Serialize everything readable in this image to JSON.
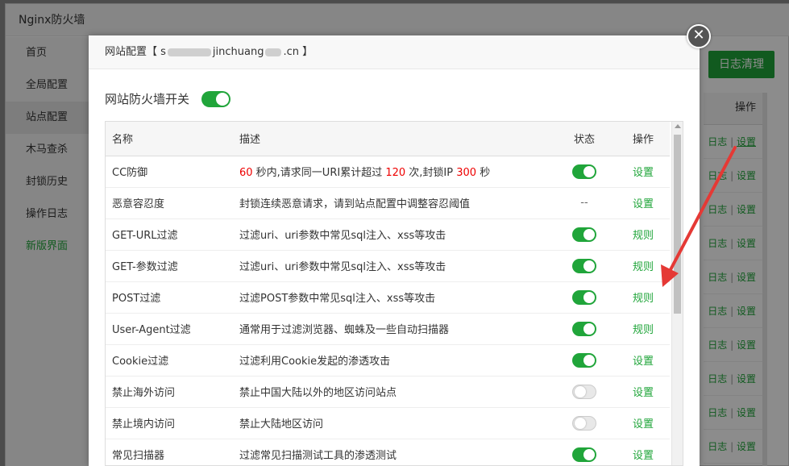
{
  "app": {
    "title": "Nginx防火墙",
    "sidebar": [
      "首页",
      "全局配置",
      "站点配置",
      "木马查杀",
      "封锁历史",
      "操作日志",
      "新版界面"
    ],
    "log_clear_button": "日志清理",
    "op_header": "操作",
    "row_links": {
      "log": "日志",
      "sep": "|",
      "set": "设置"
    }
  },
  "modal": {
    "title_prefix": "网站配置【 s",
    "title_suffix": "jinchuang",
    "title_end": ".cn 】",
    "firewall_switch_label": "网站防火墙开关",
    "columns": {
      "name": "名称",
      "desc": "描述",
      "state": "状态",
      "op": "操作"
    },
    "rows": [
      {
        "name": "CC防御",
        "desc_parts": [
          "60",
          " 秒内,请求同一URI累计超过 ",
          "120",
          " 次,封锁IP ",
          "300",
          " 秒"
        ],
        "state": "on",
        "op": "设置"
      },
      {
        "name": "恶意容忍度",
        "desc": "封锁连续恶意请求，请到站点配置中调整容忍阈值",
        "state": "--",
        "op": "设置"
      },
      {
        "name": "GET-URL过滤",
        "desc": "过滤uri、uri参数中常见sql注入、xss等攻击",
        "state": "on",
        "op": "规则"
      },
      {
        "name": "GET-参数过滤",
        "desc": "过滤uri、uri参数中常见sql注入、xss等攻击",
        "state": "on",
        "op": "规则"
      },
      {
        "name": "POST过滤",
        "desc": "过滤POST参数中常见sql注入、xss等攻击",
        "state": "on",
        "op": "规则"
      },
      {
        "name": "User-Agent过滤",
        "desc": "通常用于过滤浏览器、蜘蛛及一些自动扫描器",
        "state": "on",
        "op": "规则"
      },
      {
        "name": "Cookie过滤",
        "desc": "过滤利用Cookie发起的渗透攻击",
        "state": "on",
        "op": "设置"
      },
      {
        "name": "禁止海外访问",
        "desc": "禁止中国大陆以外的地区访问站点",
        "state": "off",
        "op": "设置"
      },
      {
        "name": "禁止境内访问",
        "desc": "禁止大陆地区访问",
        "state": "off",
        "op": "设置"
      },
      {
        "name": "常见扫描器",
        "desc": "过滤常见扫描测试工具的渗透测试",
        "state": "on",
        "op": "设置"
      }
    ]
  },
  "colors": {
    "accent": "#20a53a",
    "danger": "#e00000",
    "arrow": "#e53935"
  }
}
